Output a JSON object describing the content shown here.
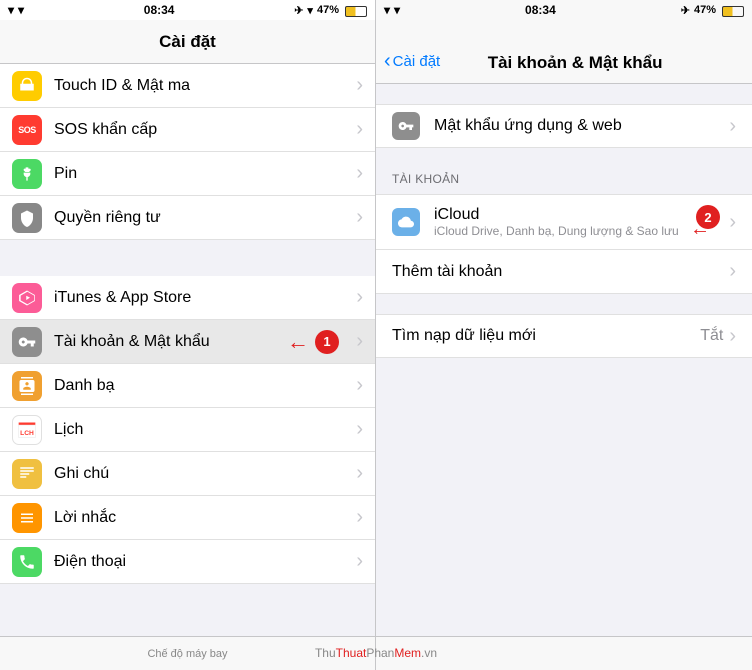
{
  "left": {
    "status": {
      "time": "08:34",
      "battery": "47%",
      "signal": "●●●",
      "wifi": "WiFi"
    },
    "title": "Cài đặt",
    "items": [
      {
        "id": "touch-id",
        "label": "Touch ID & Mật ma",
        "iconColor": "#ffcc00",
        "icon": "🔒",
        "highlighted": false
      },
      {
        "id": "sos",
        "label": "SOS khẩn cấp",
        "iconColor": "#ff3b30",
        "icon": "SOS",
        "highlighted": false
      },
      {
        "id": "pin",
        "label": "Pin",
        "iconColor": "#4cd964",
        "icon": "🔋",
        "highlighted": false
      },
      {
        "id": "privacy",
        "label": "Quyền riêng tư",
        "iconColor": "#888",
        "icon": "✋",
        "highlighted": false
      },
      {
        "id": "itunes",
        "label": "iTunes & App Store",
        "iconColor": "#fc5c97",
        "icon": "A",
        "highlighted": false
      },
      {
        "id": "accounts",
        "label": "Tài khoản & Mật khẩu",
        "iconColor": "#8e8e8e",
        "icon": "🔑",
        "highlighted": true
      },
      {
        "id": "contacts",
        "label": "Danh bạ",
        "iconColor": "#f0a030",
        "icon": "👤",
        "highlighted": false
      },
      {
        "id": "calendar",
        "label": "Lịch",
        "iconColor": "#ff3b30",
        "icon": "📅",
        "highlighted": false
      },
      {
        "id": "notes",
        "label": "Ghi chú",
        "iconColor": "#f0c040",
        "icon": "📝",
        "highlighted": false
      },
      {
        "id": "reminders",
        "label": "Lời nhắc",
        "iconColor": "#ff9500",
        "icon": "≡",
        "highlighted": false
      },
      {
        "id": "phone",
        "label": "Điện thoại",
        "iconColor": "#4cd964",
        "icon": "📞",
        "highlighted": false
      }
    ],
    "bottomText": "Chế độ máy bay"
  },
  "right": {
    "status": {
      "time": "08:34",
      "battery": "47%"
    },
    "backLabel": "Cài đặt",
    "title": "Tài khoản & Mật khẩu",
    "sections": [
      {
        "id": "passwords",
        "items": [
          {
            "id": "passwords-web",
            "icon": "🔑",
            "iconColor": "#888",
            "label": "Mật khẩu ứng dụng & web",
            "sub": "",
            "value": "",
            "hasChevron": true
          }
        ]
      },
      {
        "id": "accounts",
        "header": "TÀI KHOẢN",
        "items": [
          {
            "id": "icloud",
            "icon": "☁️",
            "iconColor": "#6bb0e8",
            "label": "iCloud",
            "sub": "iCloud Drive, Danh bạ, Dung lượng & Sao lưu",
            "value": "",
            "hasChevron": true
          },
          {
            "id": "add-account",
            "icon": "",
            "iconColor": "transparent",
            "label": "Thêm tài khoản",
            "sub": "",
            "value": "",
            "hasChevron": true
          }
        ]
      },
      {
        "id": "fetch",
        "items": [
          {
            "id": "fetch-data",
            "icon": "",
            "iconColor": "transparent",
            "label": "Tìm nạp dữ liệu mới",
            "sub": "",
            "value": "Tắt",
            "hasChevron": true
          }
        ]
      }
    ]
  },
  "watermark": "ThuThuatPhanMem.vn",
  "annotation1": {
    "number": "1",
    "label": "annotation-1"
  },
  "annotation2": {
    "number": "2",
    "label": "annotation-2"
  }
}
